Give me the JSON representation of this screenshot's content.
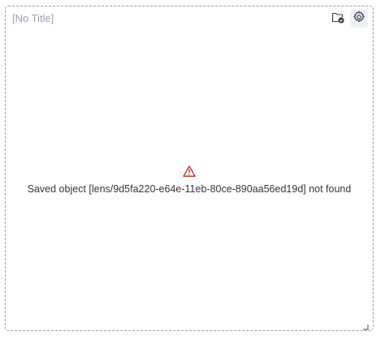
{
  "panel": {
    "title": "[No Title]",
    "error_message": "Saved object [lens/9d5fa220-e64e-11eb-80ce-890aa56ed19d] not found"
  },
  "icons": {
    "library": "folder-check-icon",
    "settings": "gear-icon",
    "warning": "warning-icon",
    "resize": "resize-handle-icon"
  },
  "colors": {
    "warning": "#bd271e",
    "text": "#343741",
    "title": "#98a2b3",
    "border": "#98a2b3"
  }
}
